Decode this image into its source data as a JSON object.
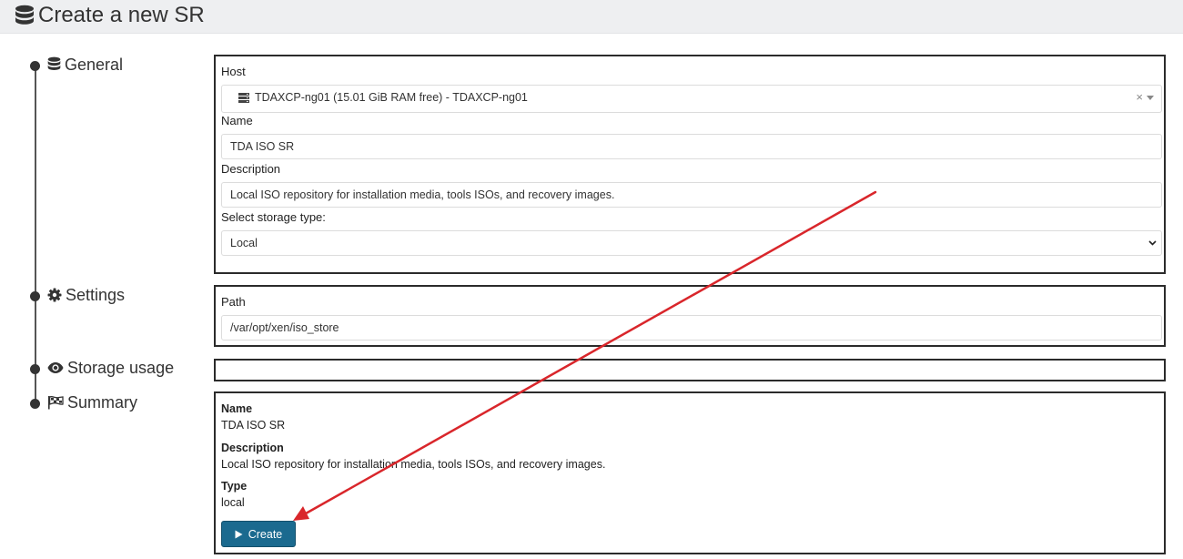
{
  "header": {
    "title": "Create a new SR"
  },
  "steps": {
    "general": "General",
    "settings": "Settings",
    "storage_usage": "Storage usage",
    "summary": "Summary"
  },
  "general": {
    "host_label": "Host",
    "host_value": "TDAXCP-ng01 (15.01 GiB RAM free) - TDAXCP-ng01",
    "host_clear": "×",
    "name_label": "Name",
    "name_value": "TDA ISO SR",
    "description_label": "Description",
    "description_value": "Local ISO repository for installation media, tools ISOs, and recovery images.",
    "storage_type_label": "Select storage type:",
    "storage_type_value": "Local"
  },
  "settings": {
    "path_label": "Path",
    "path_value": "/var/opt/xen/iso_store"
  },
  "summary": {
    "name_title": "Name",
    "name_value": "TDA ISO SR",
    "description_title": "Description",
    "description_value": "Local ISO repository for installation media, tools ISOs, and recovery images.",
    "type_title": "Type",
    "type_value": "local",
    "create_label": "Create"
  },
  "colors": {
    "button": "#1b6a8f",
    "annotation_arrow": "#d9262b",
    "header_bg": "#eeeff1"
  }
}
